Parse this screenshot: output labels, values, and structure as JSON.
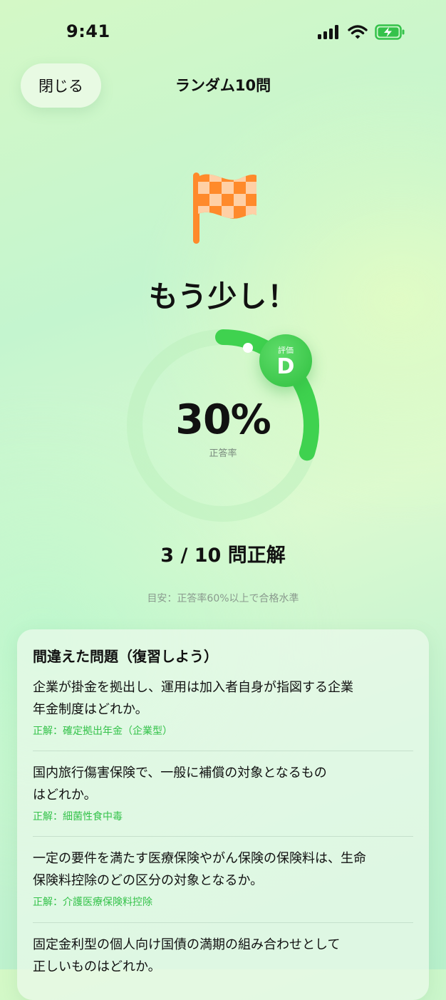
{
  "status_bar": {
    "time": "9:41"
  },
  "header": {
    "close_label": "閉じる",
    "title": "ランダム10問"
  },
  "result": {
    "headline": "もう少し！",
    "percent_text": "30%",
    "percent_label": "正答率",
    "progress_fraction": 0.3,
    "grade_label": "評価",
    "grade_value": "D",
    "score_text": "3 / 10 問正解",
    "hint": "目安：正答率60%以上で合格水準"
  },
  "review": {
    "title": "間違えた問題（復習しよう）",
    "items": [
      {
        "line1": "企業が掛金を拠出し、運用は加入者自身が指図する企業",
        "line2": "年金制度はどれか。",
        "answer": "正解：確定拠出年金（企業型）"
      },
      {
        "line1": "国内旅行傷害保険で、一般に補償の対象となるもの",
        "line2": "はどれか。",
        "answer": "正解：細菌性食中毒"
      },
      {
        "line1": "一定の要件を満たす医療保険やがん保険の保険料は、生命",
        "line2": "保険料控除のどの区分の対象となるか。",
        "answer": "正解：介護医療保険料控除"
      },
      {
        "line1": "固定金利型の個人向け国債の満期の組み合わせとして",
        "line2": "正しいものはどれか。",
        "answer": ""
      }
    ]
  },
  "colors": {
    "accent": "#34c24a",
    "flag": "#ff8a2b"
  },
  "icons": {
    "flag": "checkered-flag-icon"
  }
}
